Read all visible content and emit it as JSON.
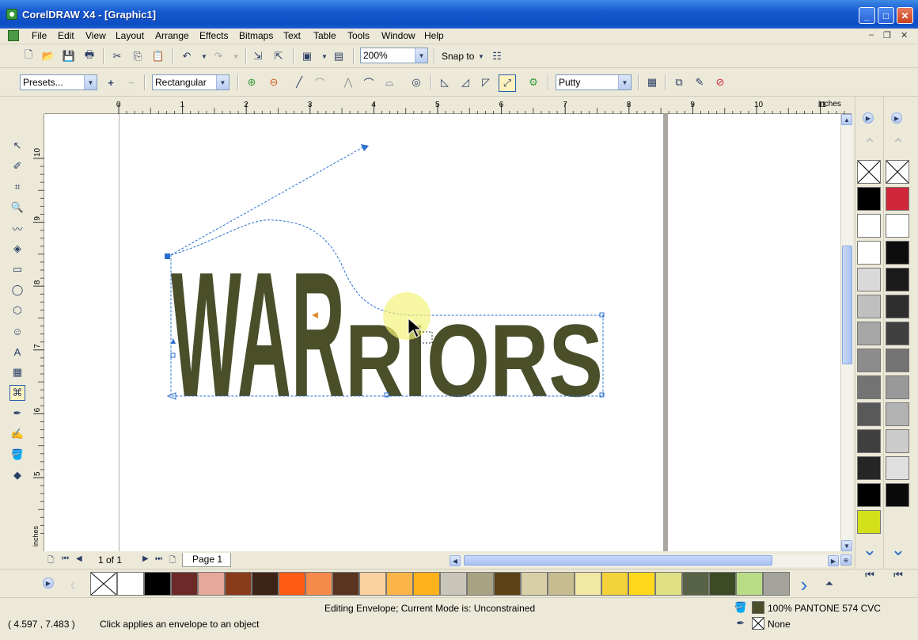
{
  "window": {
    "title": "CorelDRAW X4 - [Graphic1]"
  },
  "menu": {
    "items": [
      "File",
      "Edit",
      "View",
      "Layout",
      "Arrange",
      "Effects",
      "Bitmaps",
      "Text",
      "Table",
      "Tools",
      "Window",
      "Help"
    ]
  },
  "toolbar1": {
    "zoom_value": "200%",
    "snap_to_label": "Snap to"
  },
  "toolbar2": {
    "presets_value": "Presets...",
    "mode_value": "Rectangular",
    "mapping_value": "Putty"
  },
  "ruler": {
    "unit": "inches",
    "h_ticks": [
      "0",
      "1",
      "2",
      "3",
      "4",
      "5",
      "6",
      "7",
      "8",
      "9",
      "10",
      "11"
    ],
    "v_ticks": [
      "10",
      "9",
      "8",
      "7",
      "6",
      "5"
    ]
  },
  "canvas": {
    "artwork_text": "WARRIORS",
    "artwork_color": "#4a4f2a"
  },
  "pagenav": {
    "page_count": "1 of 1",
    "page_tab": "Page 1"
  },
  "palette": {
    "colors": [
      "#ffffff",
      "#000000",
      "#6b2a28",
      "#e6a89a",
      "#8a3b1a",
      "#3d2417",
      "#ff5a14",
      "#f58b4a",
      "#5a3420",
      "#fbd1a2",
      "#fdb54a",
      "#ffb21a",
      "#c9c5b8",
      "#a7a284",
      "#5a4216",
      "#d9cfa6",
      "#c7bc90",
      "#f2e8a6",
      "#f3d23a",
      "#ffd81c",
      "#dfe184",
      "#586246",
      "#3c4a26",
      "#b8dd86",
      "#a4a49c"
    ]
  },
  "right_palette_1": {
    "colors": [
      "#000000",
      "#ffffff",
      "#ffffff",
      "#d9d9d9",
      "#bfbfbf",
      "#a6a6a6",
      "#8c8c8c",
      "#737373",
      "#595959",
      "#404040",
      "#262626",
      "#000000",
      "#d4e01a"
    ]
  },
  "right_palette_2": {
    "colors": [
      "#d0273a",
      "#ffffff",
      "#0d0d0d",
      "#1a1a1a",
      "#2e2e2e",
      "#404040",
      "#737373",
      "#999999",
      "#b3b3b3",
      "#cccccc",
      "#e0e0e0",
      "#0a0a0a"
    ]
  },
  "status": {
    "coords": "( 4.597 , 7.483 )",
    "hint": "Click applies an envelope to an object",
    "mode": "Editing Envelope;  Current Mode is: Unconstrained",
    "fill_label": "100% PANTONE 574 CVC",
    "fill_color": "#4a4f2a",
    "outline_label": "None"
  }
}
